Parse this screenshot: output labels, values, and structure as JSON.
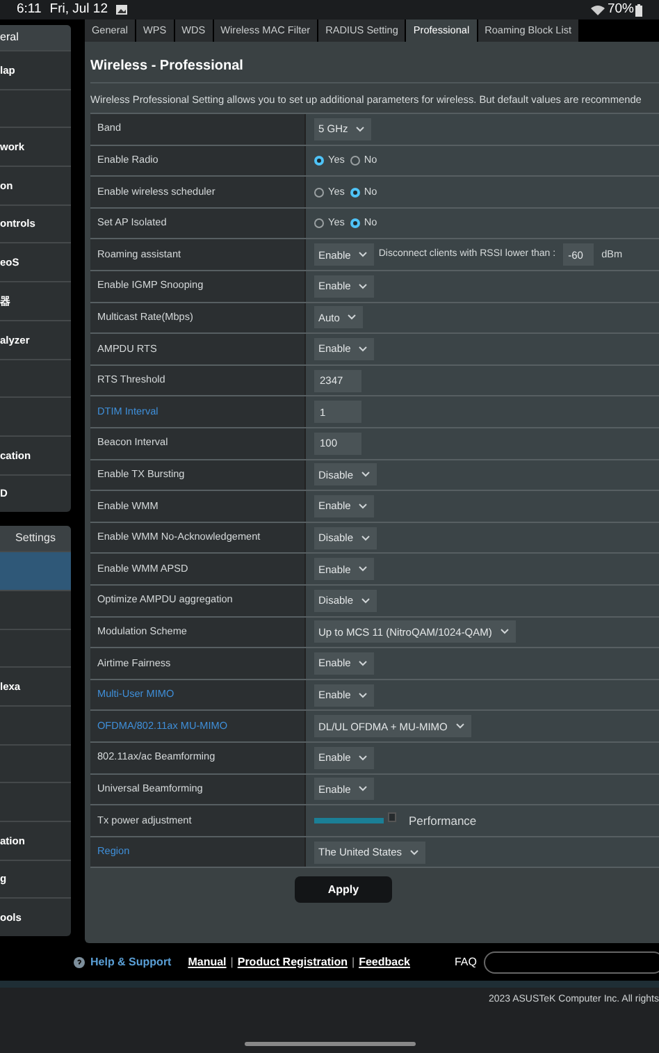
{
  "status_bar": {
    "time": "6:11",
    "date": "Fri, Jul 12",
    "battery": "70%"
  },
  "sidebar": {
    "groups": [
      {
        "header": "eral",
        "items": [
          {
            "label": "lap",
            "selected": false
          },
          {
            "selected": false
          },
          {
            "label": "work",
            "selected": false
          },
          {
            "label": "on",
            "selected": false
          },
          {
            "label": "ontrols",
            "selected": false
          },
          {
            "label": "eoS",
            "selected": false
          },
          {
            "label": "器",
            "selected": false
          },
          {
            "label": "alyzer",
            "selected": false
          },
          {
            "selected": false
          },
          {
            "selected": false
          },
          {
            "label": "cation",
            "selected": false
          },
          {
            "label": "D",
            "selected": false
          }
        ]
      },
      {
        "header": "Settings",
        "items": [
          {
            "selected": true
          },
          {
            "selected": false
          },
          {
            "selected": false
          },
          {
            "label": "lexa",
            "selected": false
          },
          {
            "selected": false
          },
          {
            "selected": false
          },
          {
            "selected": false
          },
          {
            "label": "ation",
            "selected": false
          },
          {
            "label": "g",
            "selected": false
          },
          {
            "label": "ools",
            "selected": false
          }
        ]
      }
    ]
  },
  "tabs": [
    {
      "label": "General",
      "selected": false
    },
    {
      "label": "WPS",
      "selected": false
    },
    {
      "label": "WDS",
      "selected": false
    },
    {
      "label": "Wireless MAC Filter",
      "selected": false
    },
    {
      "label": "RADIUS Setting",
      "selected": false
    },
    {
      "label": "Professional",
      "selected": true
    },
    {
      "label": "Roaming Block List",
      "selected": false
    }
  ],
  "title": "Wireless - Professional",
  "description": "Wireless Professional Setting allows you to set up additional parameters for wireless. But default values are recommende",
  "rows": [
    {
      "label": "Band",
      "link": false,
      "kind": "select",
      "value": "5 GHz"
    },
    {
      "label": "Enable Radio",
      "link": false,
      "kind": "radio",
      "options": [
        {
          "label": "Yes",
          "selected": true
        },
        {
          "label": "No",
          "selected": false
        }
      ]
    },
    {
      "label": "Enable wireless scheduler",
      "link": false,
      "kind": "radio",
      "options": [
        {
          "label": "Yes",
          "selected": false
        },
        {
          "label": "No",
          "selected": true
        }
      ]
    },
    {
      "label": "Set AP Isolated",
      "link": false,
      "kind": "radio",
      "options": [
        {
          "label": "Yes",
          "selected": false
        },
        {
          "label": "No",
          "selected": true
        }
      ]
    },
    {
      "label": "Roaming assistant",
      "link": false,
      "kind": "rssi",
      "value": "Enable",
      "text": "Disconnect clients with RSSI lower than :",
      "input": "-60",
      "unit": "dBm"
    },
    {
      "label": "Enable IGMP Snooping",
      "link": false,
      "kind": "select",
      "value": "Enable"
    },
    {
      "label": "Multicast Rate(Mbps)",
      "link": false,
      "kind": "select",
      "value": "Auto"
    },
    {
      "label": "AMPDU RTS",
      "link": false,
      "kind": "select",
      "value": "Enable"
    },
    {
      "label": "RTS Threshold",
      "link": false,
      "kind": "input",
      "value": "2347"
    },
    {
      "label": "DTIM Interval",
      "link": true,
      "kind": "input",
      "value": "1"
    },
    {
      "label": "Beacon Interval",
      "link": false,
      "kind": "input",
      "value": "100"
    },
    {
      "label": "Enable TX Bursting",
      "link": false,
      "kind": "select",
      "value": "Disable"
    },
    {
      "label": "Enable WMM",
      "link": false,
      "kind": "select",
      "value": "Enable"
    },
    {
      "label": "Enable WMM No-Acknowledgement",
      "link": false,
      "kind": "select",
      "value": "Disable"
    },
    {
      "label": "Enable WMM APSD",
      "link": false,
      "kind": "select",
      "value": "Enable"
    },
    {
      "label": "Optimize AMPDU aggregation",
      "link": false,
      "kind": "select",
      "value": "Disable"
    },
    {
      "label": "Modulation Scheme",
      "link": false,
      "kind": "select",
      "value": "Up to MCS 11 (NitroQAM/1024-QAM)"
    },
    {
      "label": "Airtime Fairness",
      "link": false,
      "kind": "select",
      "value": "Enable"
    },
    {
      "label": "Multi-User MIMO",
      "link": true,
      "kind": "select",
      "value": "Enable"
    },
    {
      "label": "OFDMA/802.11ax MU-MIMO",
      "link": true,
      "kind": "select",
      "value": "DL/UL OFDMA + MU-MIMO"
    },
    {
      "label": "802.11ax/ac Beamforming",
      "link": false,
      "kind": "select",
      "value": "Enable"
    },
    {
      "label": "Universal Beamforming",
      "link": false,
      "kind": "select",
      "value": "Enable"
    },
    {
      "label": "Tx power adjustment",
      "link": false,
      "kind": "slider",
      "level": 1,
      "value": "Performance"
    },
    {
      "label": "Region",
      "link": true,
      "kind": "select",
      "value": "The United States"
    }
  ],
  "apply_button": "Apply",
  "footer": {
    "help": "Help & Support",
    "links": [
      "Manual",
      "|",
      "Product Registration",
      "|",
      "Feedback"
    ],
    "faq": "FAQ"
  },
  "copyright": "2023 ASUSTeK Computer Inc. All rights"
}
